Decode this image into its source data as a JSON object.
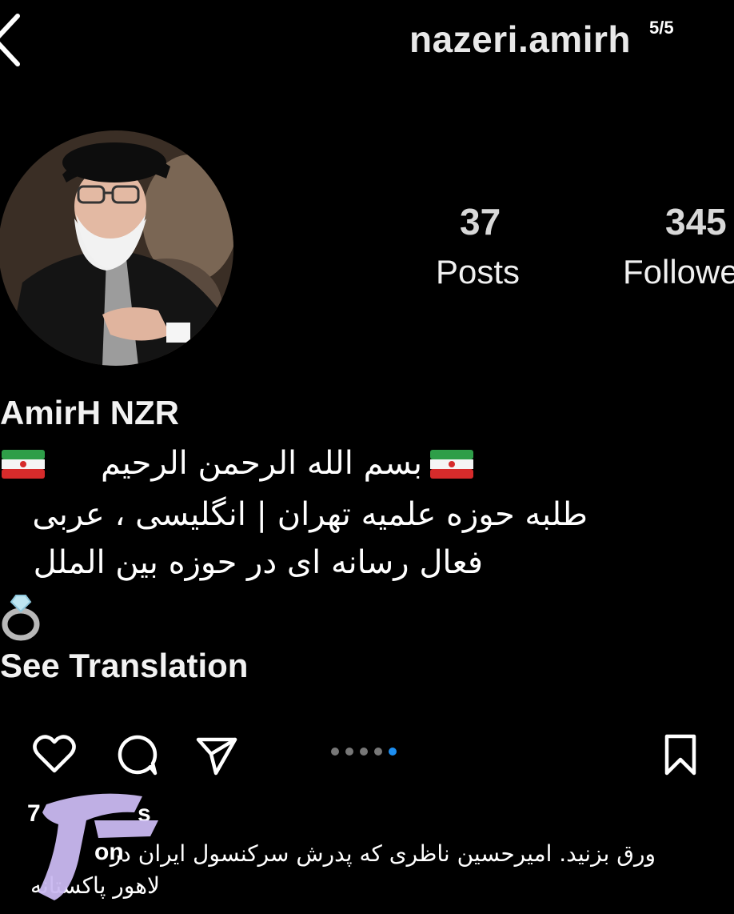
{
  "header": {
    "username": "nazeri.amirh",
    "page_counter": "5/5"
  },
  "stats": {
    "posts_count": "37",
    "posts_label": "Posts",
    "followers_count": "345",
    "followers_label": "Followers"
  },
  "bio": {
    "display_name": "AmirH NZR",
    "line1": "بسم الله الرحمن الرحیم",
    "line2": "طلبه حوزه علمیه تهران | انگلیسی ، عربی",
    "line3": "فعال رسانه ای در حوزه بین الملل",
    "see_translation": "See Translation"
  },
  "post": {
    "carousel_total": 5,
    "carousel_active": 5,
    "likes_prefix": "7",
    "likes_suffix": "s",
    "caption_fragment": "on",
    "caption_line1": "ورق بزنید. امیرحسین ناظری که پدرش سرکنسول ایران در",
    "caption_line2": "لاهور پاکستانه"
  },
  "icons": {
    "back": "chevron-left-icon",
    "heart": "heart-icon",
    "comment": "comment-icon",
    "share": "send-icon",
    "bookmark": "bookmark-icon",
    "ring": "ring-icon",
    "flag": "iran-flag-icon"
  },
  "colors": {
    "background": "#000000",
    "carousel_active": "#1d8ff2",
    "redaction": "#c9b8f0"
  }
}
